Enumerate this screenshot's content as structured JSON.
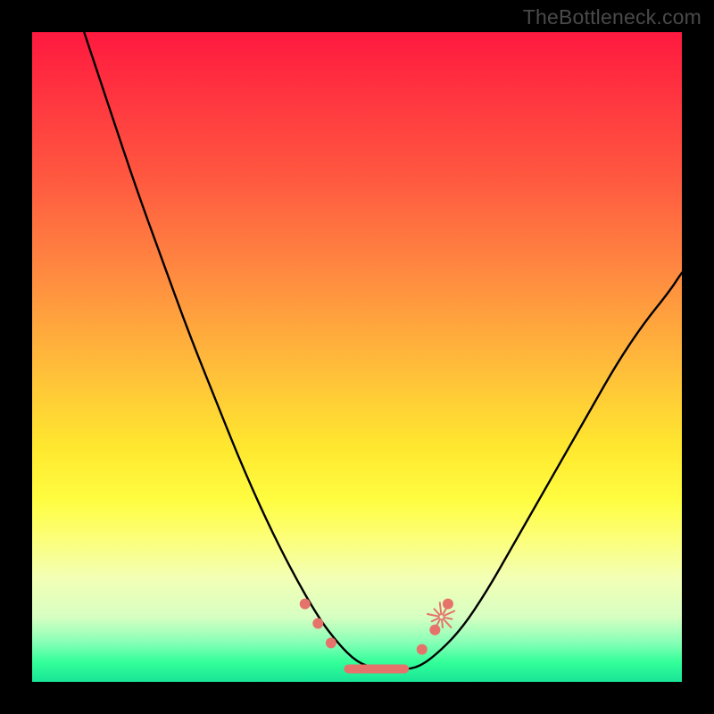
{
  "watermark": "TheBottleneck.com",
  "colors": {
    "frame": "#000000",
    "gradient_top": "#ff193f",
    "gradient_mid": "#ffe82f",
    "gradient_bottom": "#18e597",
    "curve": "#000000",
    "marker": "#e5736c"
  },
  "chart_data": {
    "type": "line",
    "title": "",
    "xlabel": "",
    "ylabel": "",
    "xlim": [
      0,
      100
    ],
    "ylim": [
      0,
      100
    ],
    "series": [
      {
        "name": "bottleneck-curve",
        "x": [
          8,
          12,
          16,
          20,
          24,
          28,
          32,
          36,
          40,
          44,
          47,
          50,
          53,
          56,
          59,
          62,
          66,
          70,
          74,
          78,
          82,
          86,
          90,
          94,
          98,
          100
        ],
        "y": [
          100,
          88,
          76,
          65,
          54,
          44,
          34,
          25,
          17,
          10,
          6,
          3,
          2,
          2,
          2,
          4,
          8,
          14,
          21,
          28,
          35,
          42,
          49,
          55,
          60,
          63
        ]
      }
    ],
    "markers": [
      {
        "x": 42,
        "y": 12
      },
      {
        "x": 44,
        "y": 9
      },
      {
        "x": 46,
        "y": 6
      },
      {
        "x": 60,
        "y": 5
      },
      {
        "x": 62,
        "y": 8
      },
      {
        "x": 64,
        "y": 12
      }
    ],
    "burst": {
      "x": 63,
      "y": 10
    },
    "valley": {
      "x0": 48,
      "x1": 58,
      "y": 2
    }
  }
}
